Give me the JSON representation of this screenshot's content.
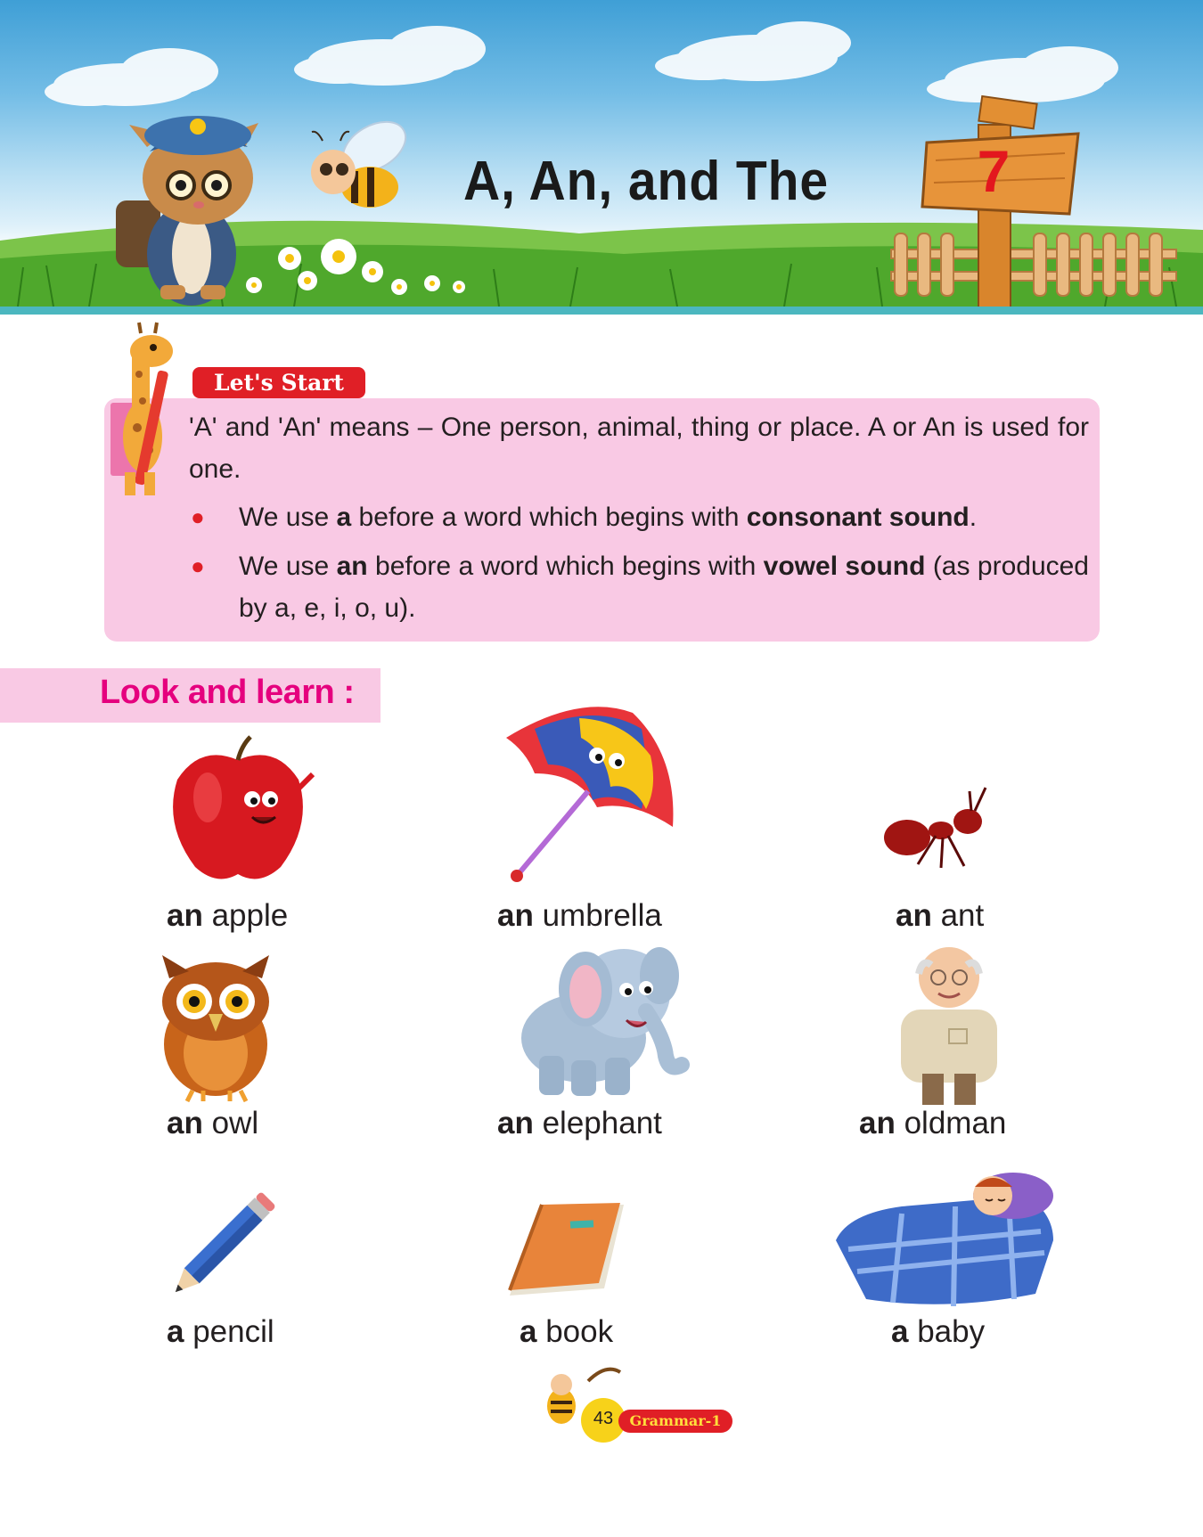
{
  "header": {
    "title": "A, An, and  The",
    "chapter_number": "7"
  },
  "lets_start": {
    "tag": "Let's Start",
    "intro": "'A' and 'An' means – One person, animal, thing or place. A or An is used for one.",
    "bullets": [
      {
        "pre": "We use ",
        "bold1": "a",
        "mid": " before a word which begins with ",
        "bold2": "consonant sound",
        "post": "."
      },
      {
        "pre": "We use ",
        "bold1": "an",
        "mid": " before a word which begins with ",
        "bold2": "vowel sound",
        "post": " (as produced by a, e, i, o, u)."
      }
    ]
  },
  "look_learn": {
    "heading": "Look and learn :",
    "items": [
      {
        "article": "an",
        "word": "apple"
      },
      {
        "article": "an",
        "word": "umbrella"
      },
      {
        "article": "an",
        "word": "ant"
      },
      {
        "article": "an",
        "word": "owl"
      },
      {
        "article": "an",
        "word": "elephant"
      },
      {
        "article": "an",
        "word": "oldman"
      },
      {
        "article": "a",
        "word": "pencil"
      },
      {
        "article": "a",
        "word": "book"
      },
      {
        "article": "a",
        "word": "baby"
      }
    ]
  },
  "footer": {
    "page_number": "43",
    "book": "Grammar-1"
  },
  "colors": {
    "accent_red": "#e01f26",
    "pink_box": "#f9c9e4",
    "magenta_heading": "#e5007e",
    "teal_line": "#4bb7bf"
  }
}
